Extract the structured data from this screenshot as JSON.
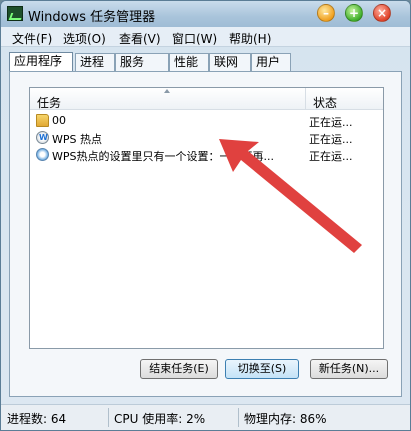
{
  "window": {
    "title": "Windows 任务管理器"
  },
  "menu": [
    "文件(F)",
    "选项(O)",
    "查看(V)",
    "窗口(W)",
    "帮助(H)"
  ],
  "tabs": [
    "应用程序",
    "进程",
    "服务",
    "性能",
    "联网",
    "用户"
  ],
  "active_tab": 0,
  "list": {
    "headers": {
      "task": "任务",
      "status": "状态"
    },
    "rows": [
      {
        "icon": "folder-icon",
        "name": "00",
        "status": "正在运..."
      },
      {
        "icon": "wps-icon",
        "name": "WPS 热点",
        "status": "正在运..."
      },
      {
        "icon": "wps-settings-icon",
        "name": "WPS热点的设置里只有一个设置：一周不再...",
        "status": "正在运..."
      }
    ]
  },
  "buttons": {
    "end_task": "结束任务(E)",
    "switch_to": "切换至(S)",
    "new_task": "新任务(N)..."
  },
  "statusbar": {
    "processes": "进程数: 64",
    "cpu": "CPU 使用率: 2%",
    "memory": "物理内存: 86%"
  },
  "colors": {
    "annotation_arrow": "#e0413f"
  }
}
